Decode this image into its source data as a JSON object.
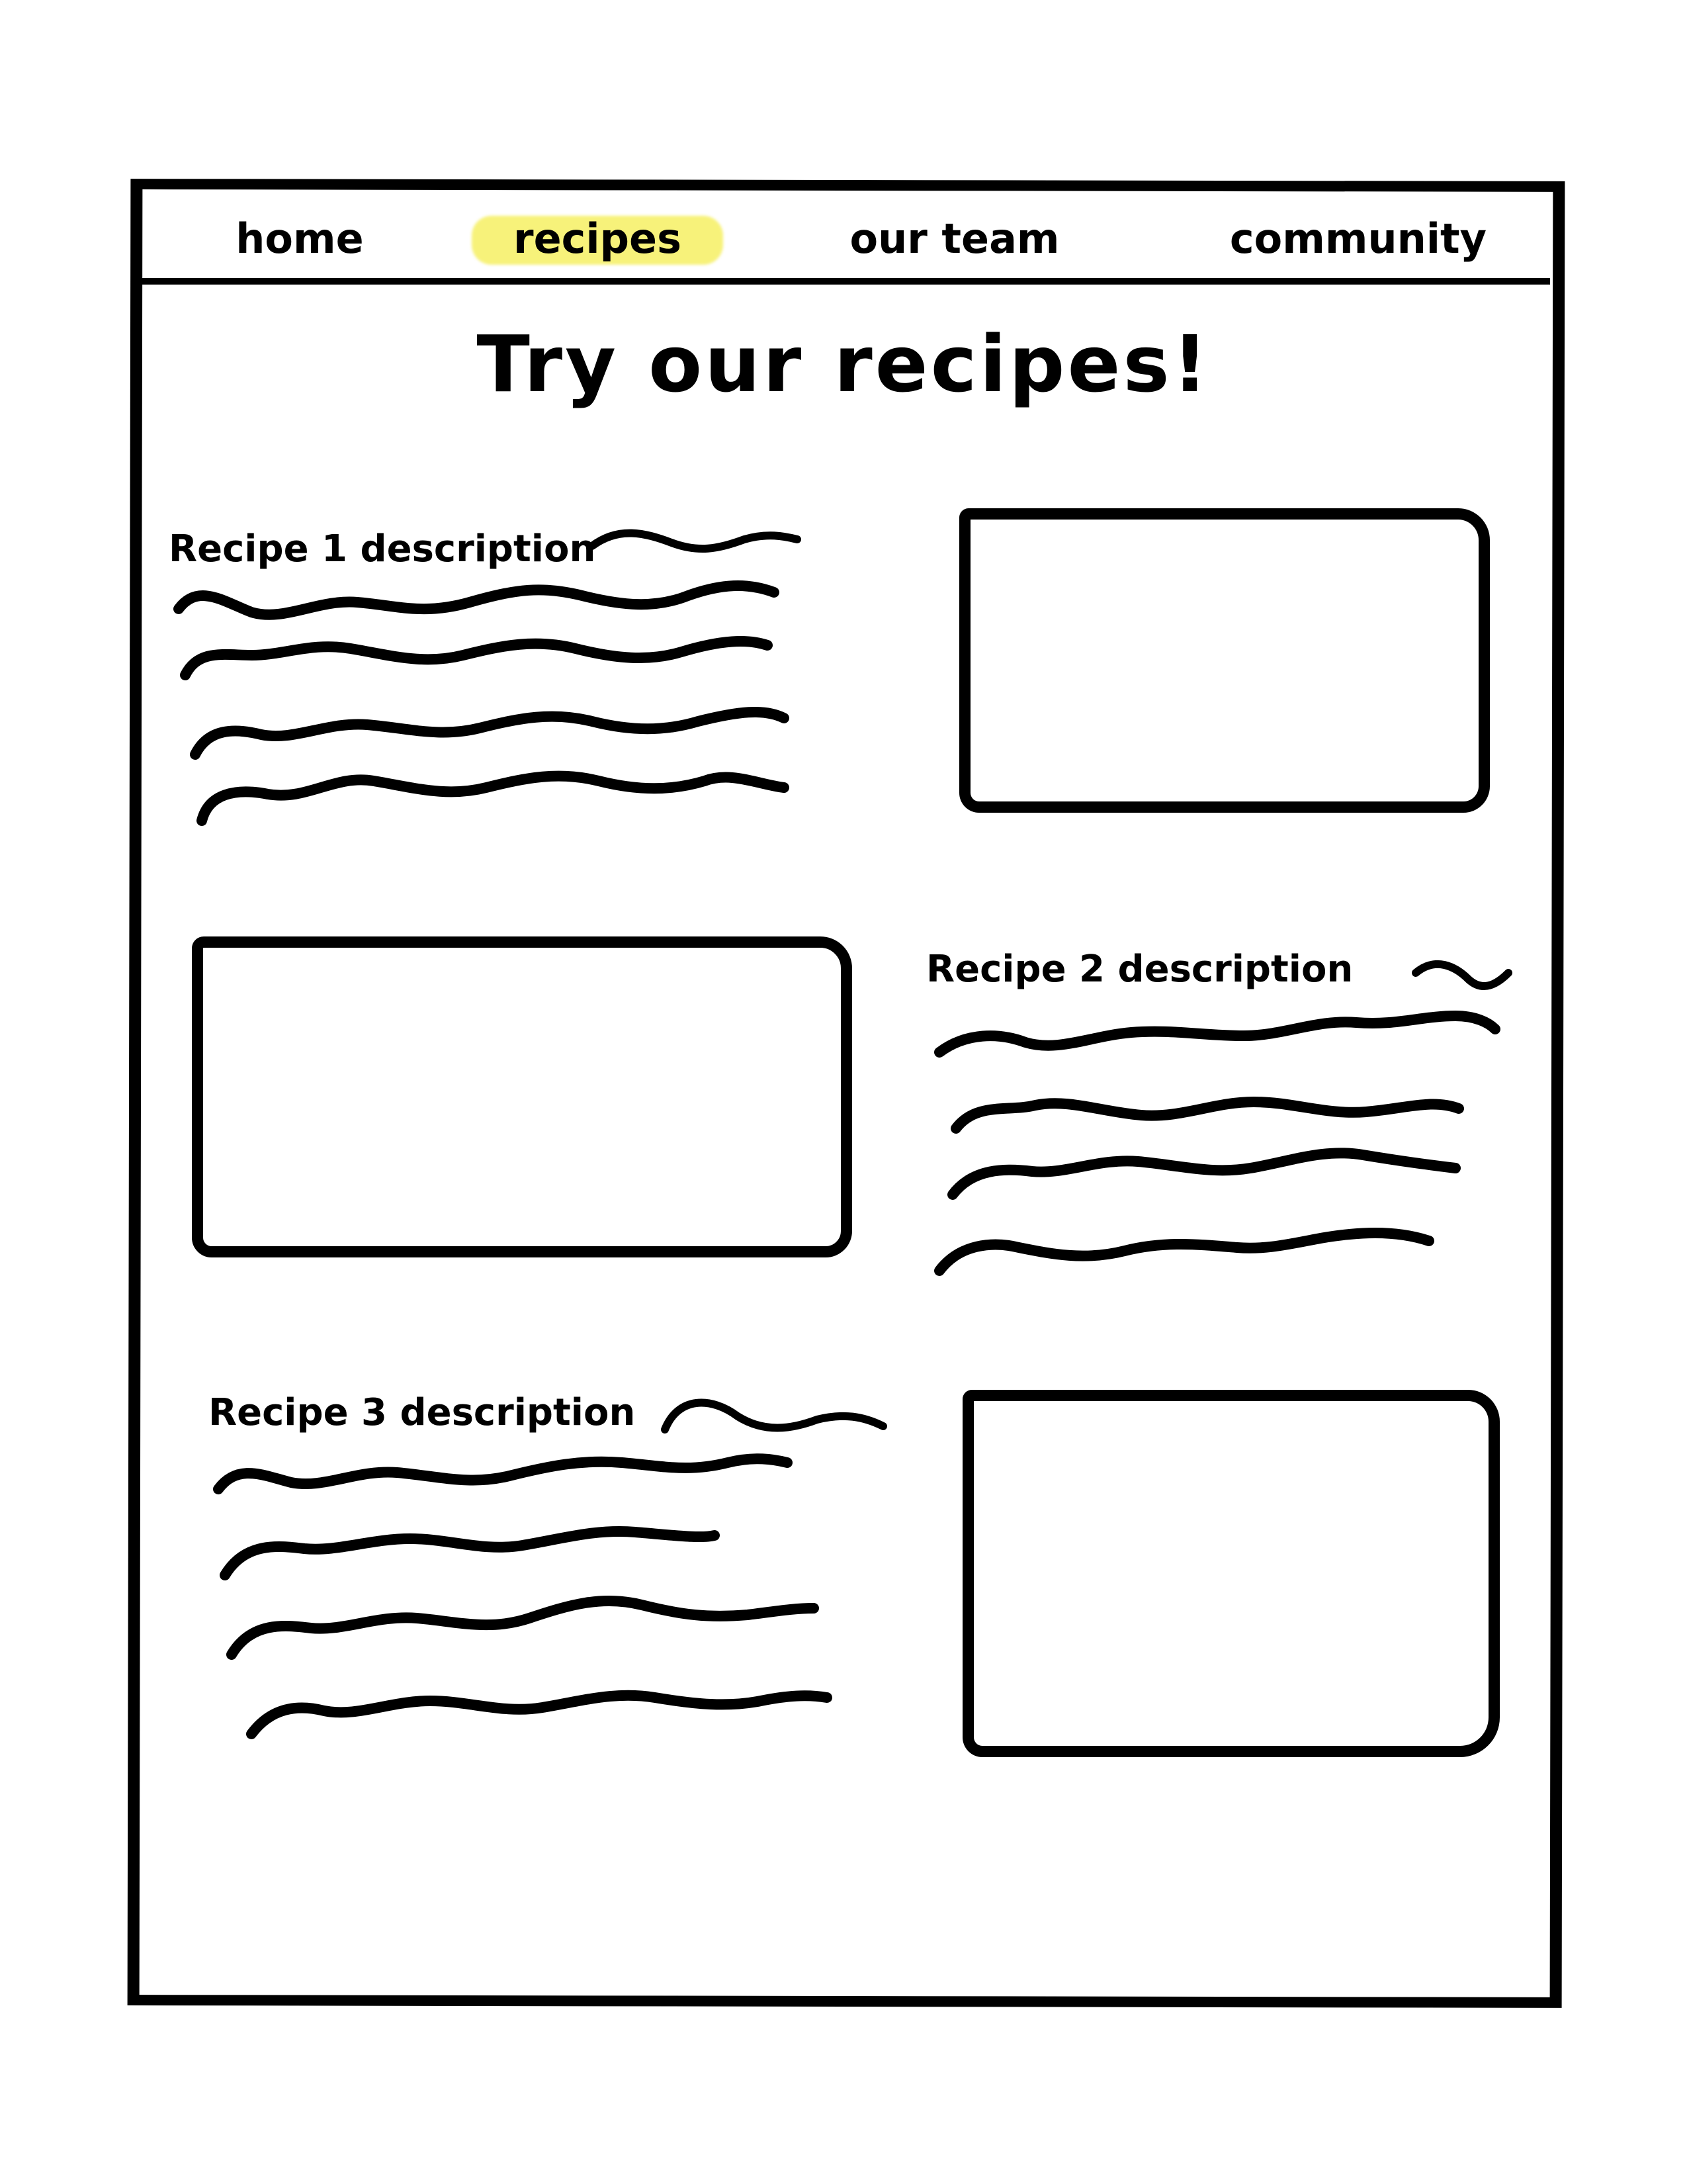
{
  "nav": {
    "items": [
      {
        "label": "home",
        "active": false
      },
      {
        "label": "recipes",
        "active": true
      },
      {
        "label": "our team",
        "active": false
      },
      {
        "label": "community",
        "active": false
      }
    ],
    "highlight_color": "#f7f27a"
  },
  "page": {
    "title": "Try our recipes!"
  },
  "recipes": [
    {
      "description_label": "Recipe 1 description"
    },
    {
      "description_label": "Recipe 2 description"
    },
    {
      "description_label": "Recipe 3 description"
    }
  ]
}
